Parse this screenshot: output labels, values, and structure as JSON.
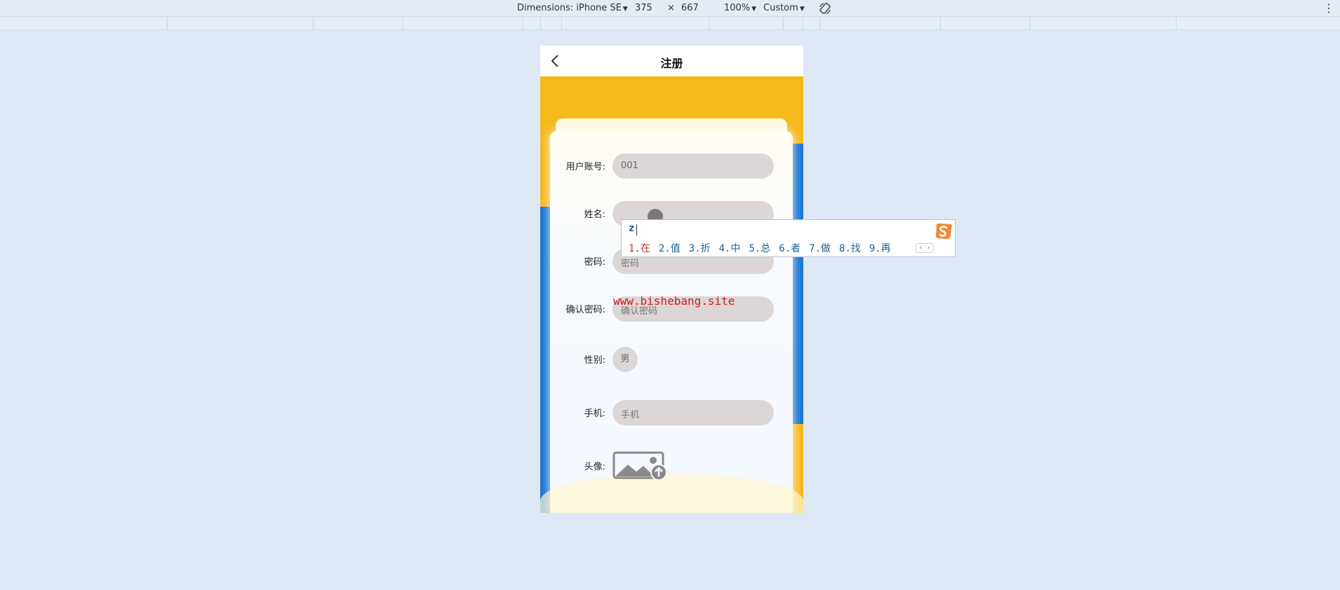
{
  "devtools": {
    "dimensions_label": "Dimensions: iPhone SE",
    "width": "375",
    "times": "×",
    "height": "667",
    "zoom": "100%",
    "throttle": "Custom",
    "rotate_icon": "rotate-icon",
    "more_icon": "more-vertical-icon"
  },
  "page": {
    "title": "注册",
    "back_icon": "chevron-left-icon"
  },
  "form": {
    "account": {
      "label": "用户账号:",
      "value": "001"
    },
    "name": {
      "label": "姓名:",
      "value": ""
    },
    "password": {
      "label": "密码:",
      "placeholder": "密码"
    },
    "confirm_password": {
      "label": "确认密码:",
      "placeholder": "确认密码"
    },
    "gender": {
      "label": "性别:",
      "value": "男"
    },
    "phone": {
      "label": "手机:",
      "placeholder": "手机"
    },
    "avatar": {
      "label": "头像:",
      "icon": "image-upload-icon"
    }
  },
  "ime": {
    "composition": "z",
    "candidates": [
      "1.在",
      "2.值",
      "3.折",
      "4.中",
      "5.总",
      "6.者",
      "7.做",
      "8.找",
      "9.再"
    ],
    "page_arrows": "‹ ›",
    "logo_icon": "sogou-logo-icon"
  },
  "watermark": "www.bishebang.site",
  "colors": {
    "yellow": "#f6b91a",
    "blue": "#1a74d2",
    "input_bg": "#dcd7d6"
  }
}
